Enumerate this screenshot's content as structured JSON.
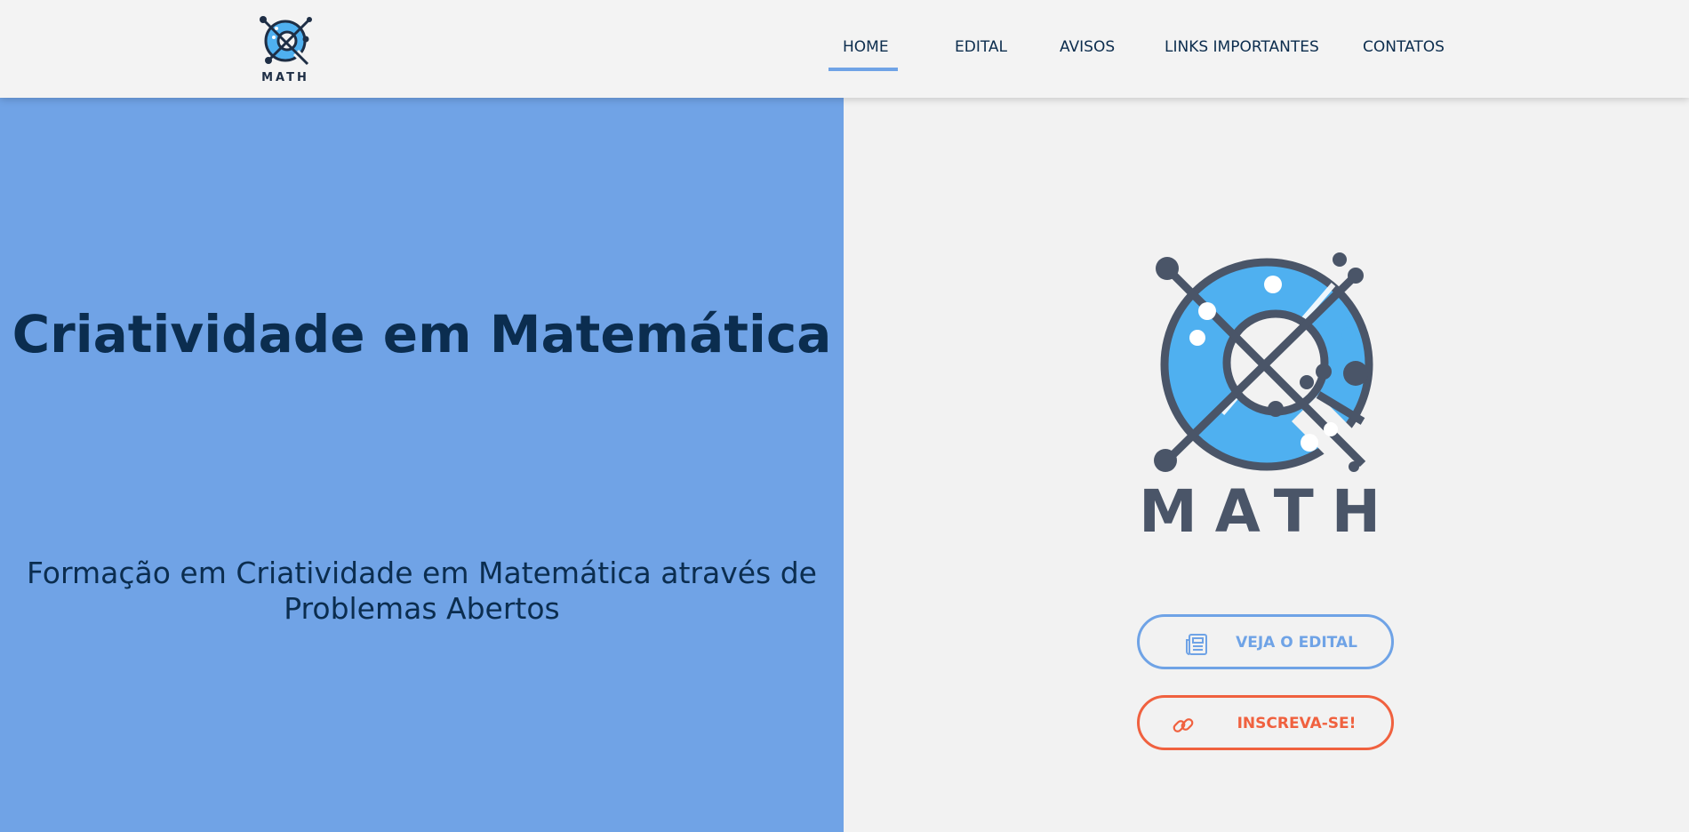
{
  "header": {
    "logo_text": "MATH",
    "nav": [
      {
        "label": "HOME",
        "active": true
      },
      {
        "label": "EDITAL",
        "active": false
      },
      {
        "label": "AVISOS",
        "active": false
      },
      {
        "label": "LINKS IMPORTANTES",
        "active": false
      },
      {
        "label": "CONTATOS",
        "active": false
      }
    ]
  },
  "hero": {
    "title": "Criatividade em Matemática",
    "subtitle": "Formação em Criatividade em Matemática através de Problemas Abertos"
  },
  "logo_big": {
    "text": "MATH"
  },
  "buttons": {
    "edital": {
      "label": "VEJA O EDITAL",
      "icon": "newspaper-icon"
    },
    "inscreva": {
      "label": "INSCREVA-SE!",
      "icon": "link-icon"
    }
  },
  "colors": {
    "accent_blue": "#6fa3e6",
    "hero_bg": "#70a3e6",
    "title_navy": "#0b2d4f",
    "cta_orange": "#f0613f",
    "logo_dark": "#4a5568",
    "logo_light_blue": "#4fb0f0"
  }
}
